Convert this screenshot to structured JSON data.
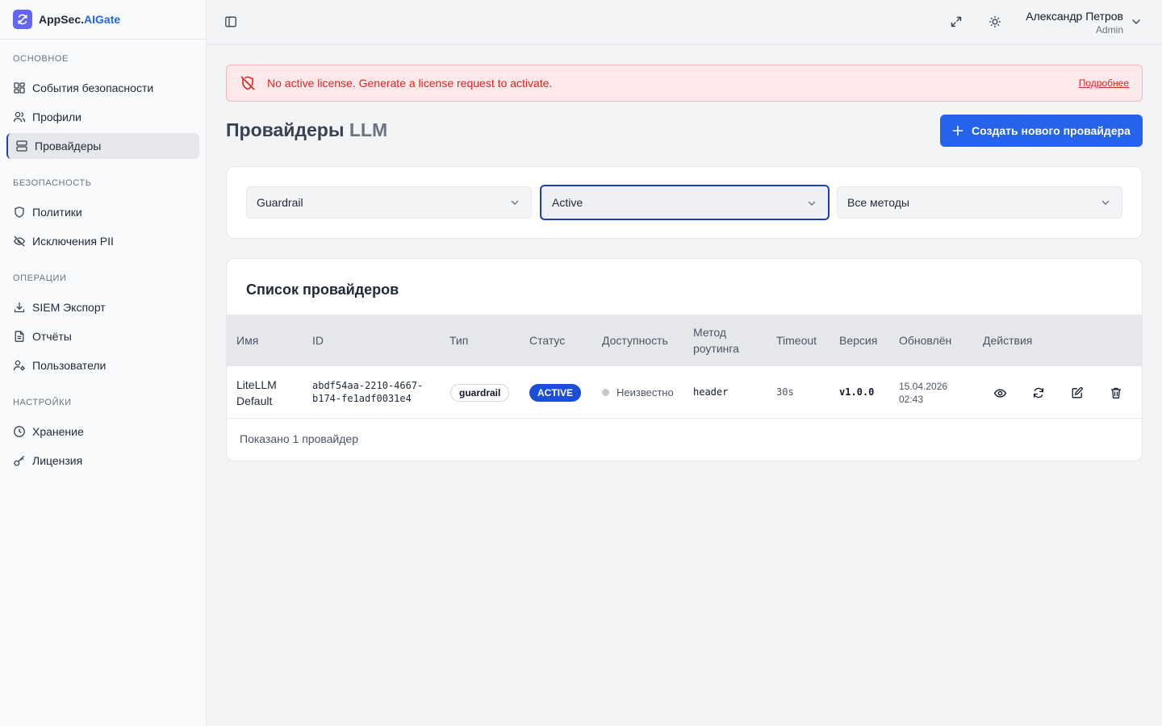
{
  "app": {
    "brand_prefix": "AppSec.",
    "brand_accent": "AIGate"
  },
  "sidebar": {
    "sections": [
      {
        "title": "ОСНОВНОЕ",
        "items": [
          {
            "label": "События безопасности",
            "icon": "dashboard-icon"
          },
          {
            "label": "Профили",
            "icon": "users-icon"
          },
          {
            "label": "Провайдеры",
            "icon": "server-icon",
            "active": true
          }
        ]
      },
      {
        "title": "БЕЗОПАСНОСТЬ",
        "items": [
          {
            "label": "Политики",
            "icon": "shield-icon"
          },
          {
            "label": "Исключения PII",
            "icon": "eye-off-icon"
          }
        ]
      },
      {
        "title": "ОПЕРАЦИИ",
        "items": [
          {
            "label": "SIEM Экспорт",
            "icon": "download-icon"
          },
          {
            "label": "Отчёты",
            "icon": "file-text-icon"
          },
          {
            "label": "Пользователи",
            "icon": "user-cog-icon"
          }
        ]
      },
      {
        "title": "НАСТРОЙКИ",
        "items": [
          {
            "label": "Хранение",
            "icon": "clock-icon"
          },
          {
            "label": "Лицензия",
            "icon": "key-icon"
          }
        ]
      }
    ]
  },
  "header": {
    "user_name": "Александр Петров",
    "user_role": "Admin"
  },
  "alert": {
    "message": "No active license. Generate a license request to activate.",
    "link": "Подробнее"
  },
  "page": {
    "title_main": "Провайдеры",
    "title_muted": "LLM",
    "create_button": "Создать нового провайдера"
  },
  "filters": {
    "type": "Guardrail",
    "status": "Active",
    "method": "Все методы"
  },
  "list": {
    "title": "Список провайдеров",
    "columns": {
      "name": "Имя",
      "id": "ID",
      "type": "Тип",
      "status": "Статус",
      "availability": "Доступность",
      "routing_line1": "Метод",
      "routing_line2": "роутинга",
      "timeout": "Timeout",
      "version": "Версия",
      "updated": "Обновлён",
      "actions": "Действия"
    },
    "rows": [
      {
        "name_line1": "LiteLLM",
        "name_line2": "Default",
        "id_line1": "abdf54aa-2210-4667-",
        "id_line2": "b174-fe1adf0031e4",
        "type": "guardrail",
        "status": "ACTIVE",
        "availability": "Неизвестно",
        "routing": "header",
        "timeout": "30s",
        "version": "v1.0.0",
        "updated_date": "15.04.2026",
        "updated_time": "02:43"
      }
    ],
    "footer": "Показано 1 провайдер"
  },
  "colors": {
    "primary": "#2563eb",
    "alert_bg": "#fde8ea",
    "alert_text": "#dc2626",
    "brand_logo": "#6366f1"
  }
}
